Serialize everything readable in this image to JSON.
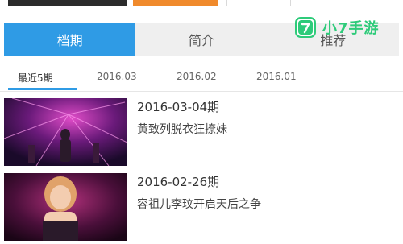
{
  "tabs": [
    {
      "label": "档期",
      "active": true
    },
    {
      "label": "简介",
      "active": false
    },
    {
      "label": "推荐",
      "active": false
    }
  ],
  "subtabs": [
    {
      "label": "最近5期",
      "active": true
    },
    {
      "label": "2016.03",
      "active": false
    },
    {
      "label": "2016.02",
      "active": false
    },
    {
      "label": "2016.01",
      "active": false
    }
  ],
  "episodes": [
    {
      "date": "2016-03-04期",
      "title": "黄致列脱衣狂撩妹"
    },
    {
      "date": "2016-02-26期",
      "title": "容祖儿李玟开启天后之争"
    }
  ],
  "watermark": {
    "icon_char": "7",
    "text": "小7手游",
    "color": "#2ecb7a"
  },
  "colors": {
    "accent": "#2f9be5",
    "tab_bg": "#efefef",
    "orange": "#f08a2c"
  }
}
